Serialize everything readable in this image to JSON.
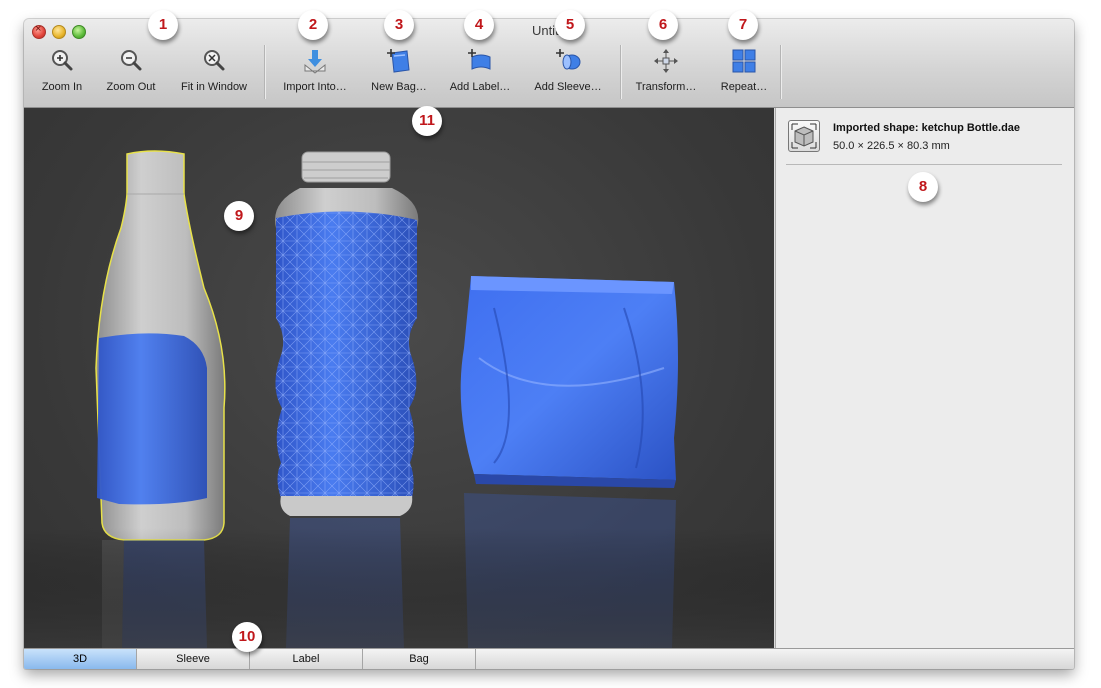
{
  "window": {
    "title": "Untitled"
  },
  "toolbar": {
    "items": [
      {
        "label": "Zoom In",
        "icon": "zoom-in-icon"
      },
      {
        "label": "Zoom Out",
        "icon": "zoom-out-icon"
      },
      {
        "label": "Fit in Window",
        "icon": "fit-window-icon"
      },
      {
        "label": "Import Into…",
        "icon": "import-icon"
      },
      {
        "label": "New Bag…",
        "icon": "new-bag-icon"
      },
      {
        "label": "Add Label…",
        "icon": "add-label-icon"
      },
      {
        "label": "Add Sleeve…",
        "icon": "add-sleeve-icon"
      },
      {
        "label": "Transform…",
        "icon": "transform-icon"
      },
      {
        "label": "Repeat…",
        "icon": "repeat-icon"
      }
    ]
  },
  "inspector": {
    "shape_title": "Imported shape: ketchup Bottle.dae",
    "shape_dims": "50.0 × 226.5 × 80.3 mm",
    "shape_icon": "cube-icon"
  },
  "tabs": [
    {
      "label": "3D",
      "active": true
    },
    {
      "label": "Sleeve",
      "active": false
    },
    {
      "label": "Label",
      "active": false
    },
    {
      "label": "Bag",
      "active": false
    }
  ],
  "callouts": [
    "1",
    "2",
    "3",
    "4",
    "5",
    "6",
    "7",
    "8",
    "9",
    "10",
    "11"
  ],
  "colors": {
    "accent_blue": "#3f6fe6",
    "selection_outline": "#e8e24a",
    "callout_text": "#c0171b",
    "viewport_bg": "#3d3d3d"
  }
}
